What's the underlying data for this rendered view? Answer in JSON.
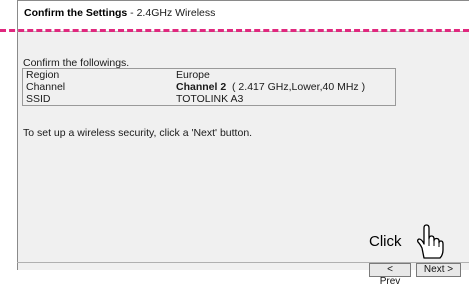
{
  "header": {
    "title_bold": "Confirm the Settings",
    "title_rest": " - 2.4GHz Wireless"
  },
  "intro_text": "Confirm the followings.",
  "settings": [
    {
      "label": "Region",
      "value_bold": "",
      "value": "Europe"
    },
    {
      "label": "Channel",
      "value_bold": "Channel 2",
      "value": "  ( 2.417 GHz,Lower,40 MHz )"
    },
    {
      "label": "SSID",
      "value_bold": "",
      "value": "TOTOLINK A3"
    }
  ],
  "instruction": "To set up a wireless security, click a 'Next' button.",
  "buttons": {
    "prev": "< Prev",
    "next": "Next >"
  },
  "callout": "Click",
  "colors": {
    "dash": "#e0287e",
    "panel": "#f0f0f0"
  }
}
